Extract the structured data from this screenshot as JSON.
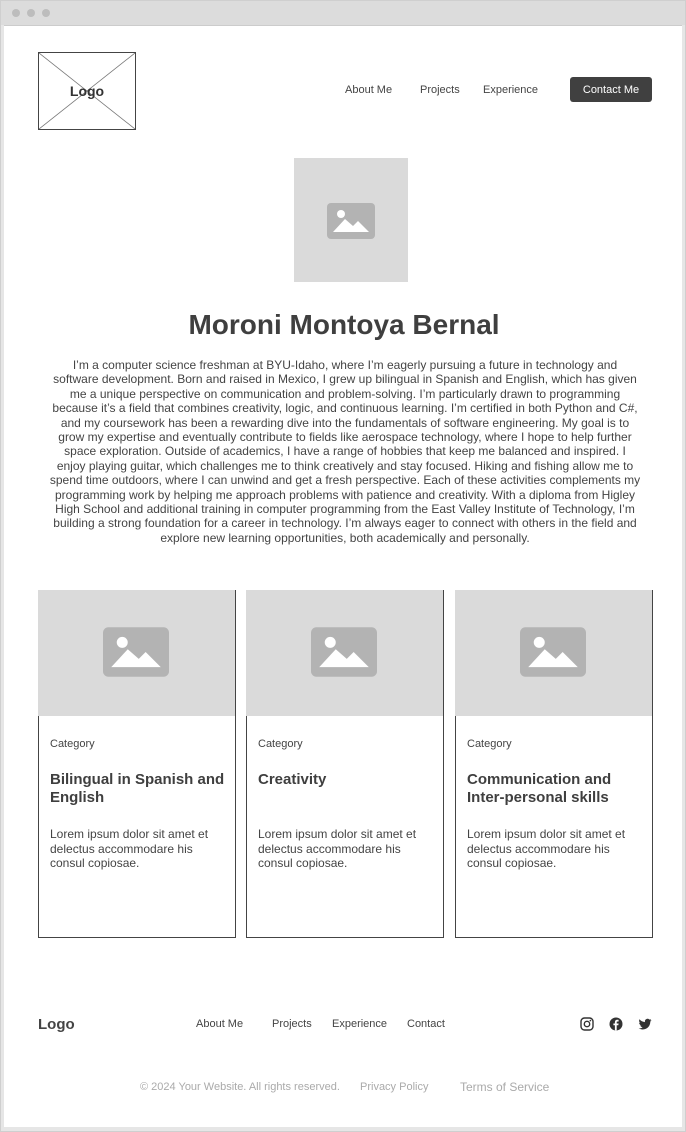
{
  "header": {
    "logo_text": "Logo",
    "nav": {
      "about": "About Me",
      "projects": "Projects",
      "experience": "Experience"
    },
    "contact_label": "Contact Me"
  },
  "hero": {
    "image_icon": "image-placeholder-icon",
    "name": "Moroni Montoya Bernal",
    "bio": "I’m a computer science freshman at BYU-Idaho, where I’m eagerly pursuing a future in technology and software development. Born and raised in Mexico, I grew up bilingual in Spanish and English, which has given me a unique perspective on communication and problem-solving. I’m particularly drawn to programming because it’s a field that combines creativity, logic, and continuous learning. I’m certified in both Python and C#, and my coursework has been a rewarding dive into the fundamentals of software engineering. My goal is to grow my expertise and eventually contribute to fields like aerospace technology, where I hope to help further space exploration. Outside of academics, I have a range of hobbies that keep me balanced and inspired. I enjoy playing guitar, which challenges me to think creatively and stay focused. Hiking and fishing allow me to spend time outdoors, where I can unwind and get a fresh perspective. Each of these activities complements my programming work by helping me approach problems with patience and creativity. With a diploma from Higley High School and additional training in computer programming from the East Valley Institute of Technology, I’m building a strong foundation for a career in technology. I’m always eager to connect with others in the field and explore new learning opportunities, both academically and personally."
  },
  "cards": [
    {
      "category": "Category",
      "title": "Bilingual in Spanish and English",
      "description": "Lorem ipsum dolor sit amet et delectus accommodare his consul copiosae."
    },
    {
      "category": "Category",
      "title": "Creativity",
      "description": "Lorem ipsum dolor sit amet et delectus accommodare his consul copiosae."
    },
    {
      "category": "Category",
      "title": "Communication and Inter-personal skills",
      "description": "Lorem ipsum dolor sit amet et delectus accommodare his consul copiosae."
    }
  ],
  "footer": {
    "logo_text": "Logo",
    "nav": {
      "about": "About Me",
      "projects": "Projects",
      "experience": "Experience",
      "contact": "Contact"
    },
    "social_icons": [
      "instagram-icon",
      "facebook-icon",
      "twitter-icon"
    ],
    "copyright": "© 2024 Your Website. All rights reserved.",
    "privacy": "Privacy Policy",
    "terms": "Terms of Service"
  },
  "colors": {
    "primary_button": "#404040",
    "placeholder_bg": "#dadada",
    "placeholder_icon": "#b3b3b3",
    "muted_text": "#aaaaaa"
  }
}
